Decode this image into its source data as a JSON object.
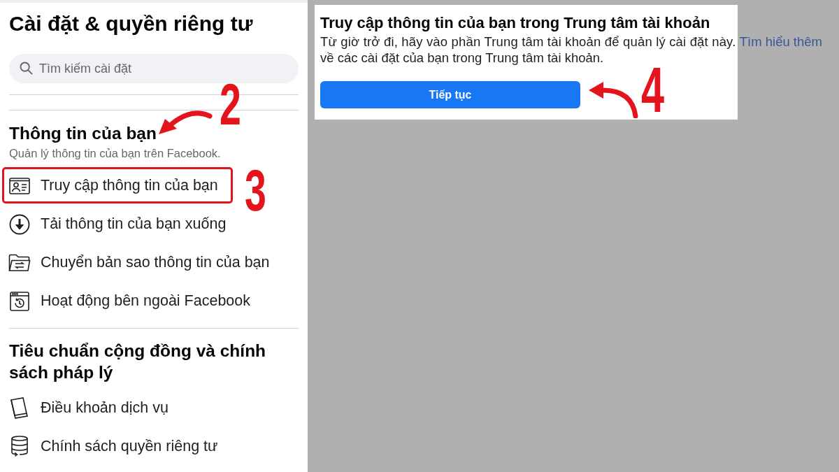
{
  "sidebar": {
    "title": "Cài đặt & quyền riêng tư",
    "search": {
      "placeholder": "Tìm kiếm cài đặt"
    },
    "sections": [
      {
        "heading": "Thông tin của bạn",
        "subtitle": "Quản lý thông tin của bạn trên Facebook.",
        "items": [
          {
            "label": "Truy cập thông tin của bạn",
            "highlighted": true
          },
          {
            "label": "Tải thông tin của bạn xuống",
            "highlighted": false
          },
          {
            "label": "Chuyển bản sao thông tin của bạn",
            "highlighted": false
          },
          {
            "label": "Hoạt động bên ngoài Facebook",
            "highlighted": false
          }
        ]
      },
      {
        "heading": "Tiêu chuẩn cộng đồng và chính sách pháp lý",
        "items": [
          {
            "label": "Điều khoản dịch vụ",
            "highlighted": false
          },
          {
            "label": "Chính sách quyền riêng tư",
            "highlighted": false
          }
        ]
      }
    ]
  },
  "dialog": {
    "title": "Truy cập thông tin của bạn trong Trung tâm tài khoản",
    "body": {
      "before_link": "Từ giờ trở đi, hãy vào phần Trung tâm tài khoản để quản lý cài đặt này. ",
      "link": "Tìm hiểu thêm",
      "after_link": " về các cài đặt của bạn trong Trung tâm tài khoản."
    },
    "button": "Tiếp tục"
  },
  "annotations": [
    {
      "label": "2",
      "arrow": true
    },
    {
      "label": "3",
      "arrow": false
    },
    {
      "label": "4",
      "arrow": true
    }
  ]
}
